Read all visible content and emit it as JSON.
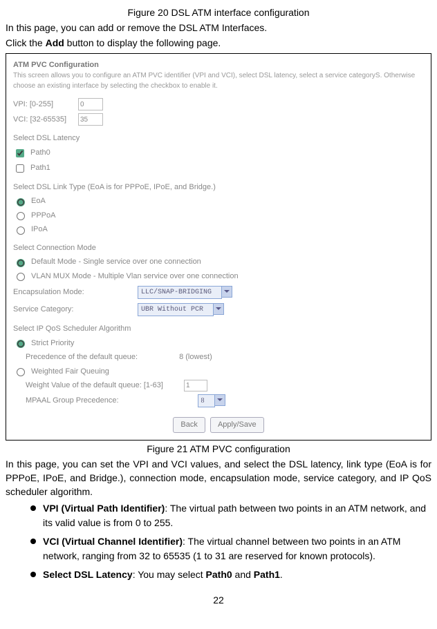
{
  "captions": {
    "fig20": "Figure 20 DSL ATM interface configuration",
    "fig21": "Figure 21 ATM PVC configuration"
  },
  "intro": {
    "line1": "In this page, you can add or remove the DSL ATM Interfaces.",
    "line2_pre": "Click the ",
    "line2_bold": "Add",
    "line2_post": " button to display the following page."
  },
  "ss": {
    "heading": "ATM PVC Configuration",
    "desc": "This screen allows you to configure an ATM PVC identifier (VPI and VCI), select DSL latency, select a service categoryS. Otherwise choose an existing interface by selecting the checkbox to enable it.",
    "vpi_label": "VPI: [0-255]",
    "vpi_value": "0",
    "vci_label": "VCI: [32-65535]",
    "vci_value": "35",
    "latency_heading": "Select DSL Latency",
    "path0": "Path0",
    "path1": "Path1",
    "link_heading": "Select DSL Link Type (EoA is for PPPoE, IPoE, and Bridge.)",
    "link_eoa": "EoA",
    "link_pppoa": "PPPoA",
    "link_ipoa": "IPoA",
    "conn_heading": "Select Connection Mode",
    "conn_default": "Default Mode - Single service over one connection",
    "conn_vlan": "VLAN MUX Mode - Multiple Vlan service over one connection",
    "encap_label": "Encapsulation Mode:",
    "encap_value": "LLC/SNAP-BRIDGING",
    "servcat_label": "Service Category:",
    "servcat_value": "UBR Without PCR",
    "qos_heading": "Select IP QoS Scheduler Algorithm",
    "qos_strict": "Strict Priority",
    "qos_prec_label": "Precedence of the default queue:",
    "qos_prec_value": "8 (lowest)",
    "qos_wfq": "Weighted Fair Queuing",
    "qos_weight_label": "Weight Value of the default queue: [1-63]",
    "qos_weight_value": "1",
    "qos_mpaal_label": "MPAAL Group Precedence:",
    "qos_mpaal_value": "8",
    "btn_back": "Back",
    "btn_apply": "Apply/Save"
  },
  "para": "In this page, you can set the VPI and VCI values, and select the DSL latency, link type (EoA is for PPPoE, IPoE, and Bridge.), connection mode, encapsulation mode, service category, and IP QoS scheduler algorithm.",
  "bullets": {
    "b1_bold": "VPI (Virtual Path Identifier)",
    "b1_rest": ": The virtual path between two points in an ATM network, and its valid value is from 0 to 255.",
    "b2_bold": "VCI (Virtual Channel Identifier)",
    "b2_rest": ": The virtual channel between two points in an ATM network, ranging from 32 to 65535 (1 to 31 are reserved for known protocols).",
    "b3_bold1": "Select DSL Latency",
    "b3_mid": ": You may select ",
    "b3_bold2": "Path0",
    "b3_and": " and ",
    "b3_bold3": "Path1",
    "b3_end": "."
  },
  "page_number": "22"
}
